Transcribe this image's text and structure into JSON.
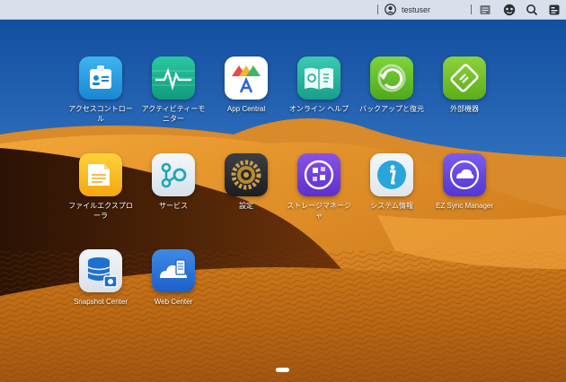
{
  "topbar": {
    "username": "testuser"
  },
  "apps": [
    {
      "label": "アクセスコントロール"
    },
    {
      "label": "アクティビティーモニター"
    },
    {
      "label": "App Central"
    },
    {
      "label": "オンライン ヘルプ"
    },
    {
      "label": "バックアップと復元"
    },
    {
      "label": "外部機器"
    },
    {
      "label": "ファイルエクスプローラ"
    },
    {
      "label": "サービス"
    },
    {
      "label": "設定"
    },
    {
      "label": "ストレージマネージャ"
    },
    {
      "label": "システム情報"
    },
    {
      "label": "EZ Sync Manager"
    },
    {
      "label": "Snapshot Center"
    },
    {
      "label": "Web Center"
    }
  ],
  "colors": {
    "sky_top": "#0f4f9f",
    "sky_bottom": "#6aa6dc",
    "dune": "#e8951e",
    "dune_shadow": "#5a2a08"
  },
  "icons": [
    "user-icon",
    "notes-icon",
    "connection-icon",
    "search-icon",
    "widget-icon",
    "pager-dot"
  ]
}
